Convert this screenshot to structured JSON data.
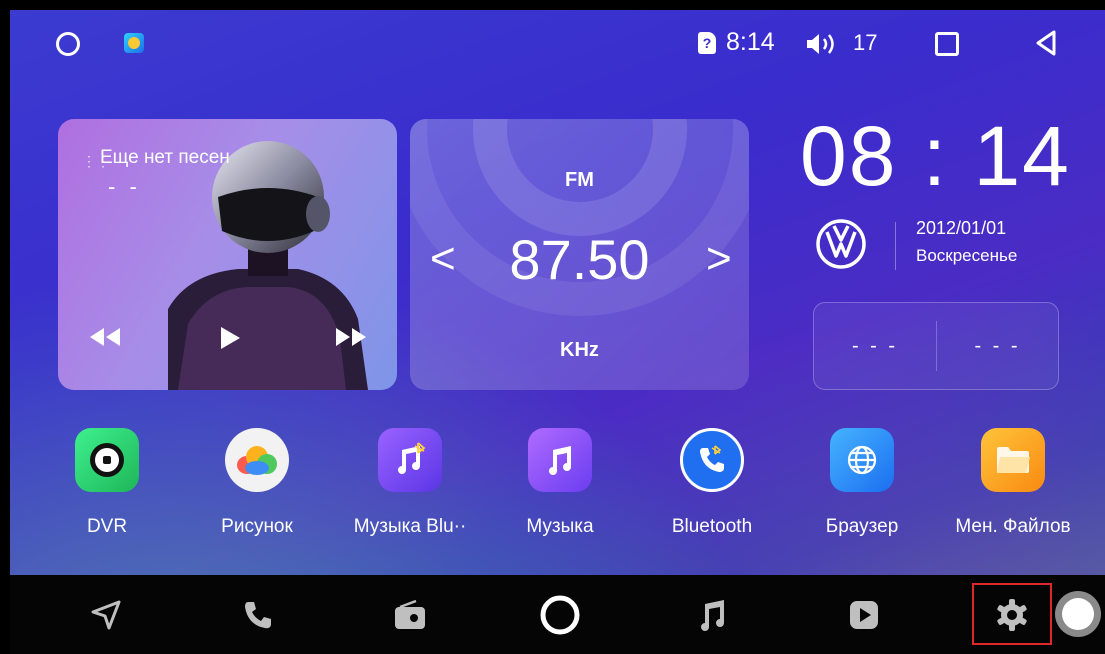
{
  "status_bar": {
    "time": "8:14",
    "volume": "17",
    "icons": [
      "home-circle-icon",
      "app-badge-icon",
      "sim-alert-icon",
      "volume-icon",
      "recents-square-icon",
      "back-triangle-icon"
    ],
    "sim_glyph": "?"
  },
  "music_widget": {
    "title": "Еще нет песен",
    "artist": "- -",
    "controls": [
      "rewind-icon",
      "play-icon",
      "fast-forward-icon"
    ]
  },
  "radio_widget": {
    "band": "FM",
    "frequency": "87.50",
    "unit": "KHz",
    "prev": "<",
    "next": ">"
  },
  "clock_widget": {
    "time": "08 : 14",
    "date": "2012/01/01",
    "weekday": "Воскресенье"
  },
  "weather_widget": {
    "left": "- - -",
    "right": "- - -"
  },
  "apps": [
    {
      "label": "DVR",
      "icon": "dvr-icon",
      "color": "#2ecf6a"
    },
    {
      "label": "Рисунок",
      "icon": "gallery-icon",
      "color": "#f4f4f4"
    },
    {
      "label": "Музыка Blu··",
      "icon": "bluetooth-music-icon",
      "color": "#7d4cf0"
    },
    {
      "label": "Музыка",
      "icon": "music-icon",
      "color": "#8a4ef2"
    },
    {
      "label": "Bluetooth",
      "icon": "bluetooth-phone-icon",
      "color": "#2d7cf2"
    },
    {
      "label": "Браузер",
      "icon": "browser-icon",
      "color": "#2f8ff5"
    },
    {
      "label": "Мен. Файлов",
      "icon": "file-manager-icon",
      "color": "#f9a21a"
    }
  ],
  "dock": [
    "navigation-icon",
    "phone-icon",
    "radio-icon",
    "home-icon",
    "music-note-icon",
    "video-icon",
    "settings-icon",
    "assistant-icon"
  ],
  "colors": {
    "highlight": "#e0282a"
  }
}
